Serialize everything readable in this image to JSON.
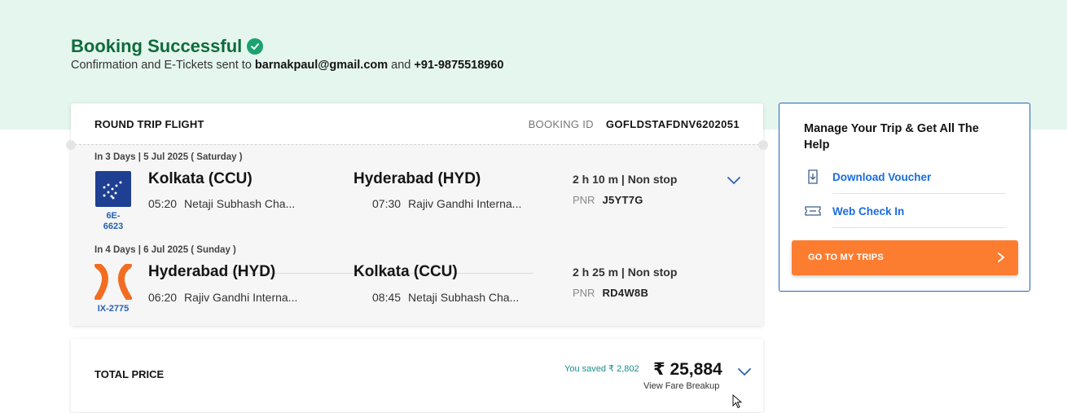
{
  "header": {
    "title": "Booking Successful",
    "subtitle_prefix": "Confirmation and E-Tickets sent to",
    "email": "barnakpaul@gmail.com",
    "and": "and",
    "phone": "+91-9875518960"
  },
  "booking": {
    "trip_type": "ROUND TRIP FLIGHT",
    "id_label": "BOOKING ID",
    "id_value": "GOFLDSTAFDNV6202051"
  },
  "segments": [
    {
      "date": "In 3 Days | 5 Jul 2025 ( Saturday )",
      "airline_logo": "indigo-logo",
      "flight_no": "6E-\n6623",
      "flight_no_l1": "6E-",
      "flight_no_l2": "6623",
      "from_city": "Kolkata (CCU)",
      "to_city": "Hyderabad (HYD)",
      "dep_time": "05:20",
      "dep_airport": "Netaji Subhash Cha...",
      "arr_time": "07:30",
      "arr_airport": "Rajiv Gandhi Interna...",
      "duration": "2 h 10 m | Non stop",
      "pnr_label": "PNR",
      "pnr": "J5YT7G"
    },
    {
      "date": "In 4 Days | 6 Jul 2025 ( Sunday )",
      "airline_logo": "air-india-express-logo",
      "flight_no": "IX-2775",
      "from_city": "Hyderabad (HYD)",
      "to_city": "Kolkata (CCU)",
      "dep_time": "06:20",
      "dep_airport": "Rajiv Gandhi Interna...",
      "arr_time": "08:45",
      "arr_airport": "Netaji Subhash Cha...",
      "duration": "2 h 25 m | Non stop",
      "pnr_label": "PNR",
      "pnr": "RD4W8B"
    }
  ],
  "total": {
    "label": "TOTAL PRICE",
    "saved": "You saved ₹ 2,802",
    "price": "₹ 25,884",
    "fare_link": "View Fare Breakup"
  },
  "help": {
    "title": "Manage Your Trip & Get All The Help",
    "items": [
      {
        "label": "Download Voucher",
        "icon": "download-voucher-icon"
      },
      {
        "label": "Web Check In",
        "icon": "ticket-icon"
      }
    ],
    "cta": "GO TO MY TRIPS"
  },
  "colors": {
    "success_green": "#0f6b3c",
    "hero_bg": "#e5f6ee",
    "link_blue": "#1b6ce0",
    "cta_orange": "#fd7d30",
    "indigo_blue": "#1f3f92",
    "ix_orange": "#f26d22",
    "saved_teal": "#1a8f8a"
  }
}
